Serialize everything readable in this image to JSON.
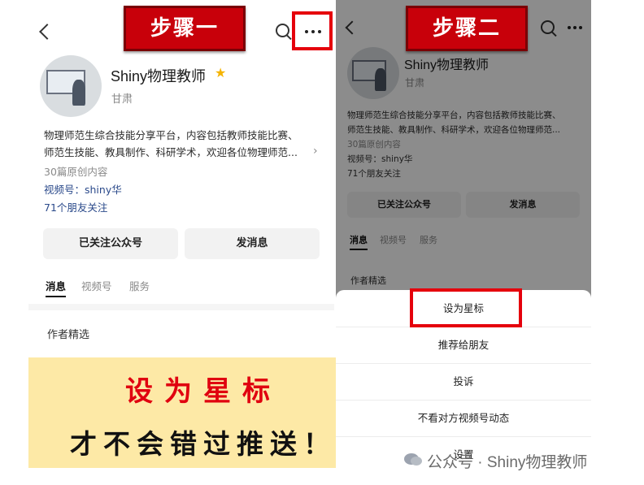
{
  "step1": {
    "banner": "步骤一"
  },
  "step2": {
    "banner": "步骤二"
  },
  "profile": {
    "name": "Shiny物理教师",
    "region": "甘肃",
    "description_line1": "物理师范生综合技能分享平台，内容包括教师技能比赛、",
    "description_line2": "师范生技能、教具制作、科研学术，欢迎各位物理师范...",
    "original_count": "30篇原创内容",
    "channels": "视频号：shiny华",
    "friends_follow": "71个朋友关注",
    "follow_button": "已关注公众号",
    "message_button": "发消息",
    "tabs": [
      "消息",
      "视频号",
      "服务"
    ],
    "section_title": "作者精选"
  },
  "sheet": {
    "items": [
      "设为星标",
      "推荐给朋友",
      "投诉",
      "不看对方视频号动态",
      "设置"
    ]
  },
  "promo": {
    "line1": "设为星标",
    "line2": "才不会错过推送！"
  },
  "watermark": {
    "text": "公众号 · Shiny物理教师"
  },
  "colors": {
    "accent_red": "#e5000c",
    "banner_red": "#c8000a",
    "promo_bg": "#fde9a6",
    "star": "#f5b400",
    "link": "#2b4a8b"
  },
  "icons": [
    "back-icon",
    "search-icon",
    "more-icon",
    "star-icon",
    "chevron-right-icon",
    "wechat-icon"
  ]
}
